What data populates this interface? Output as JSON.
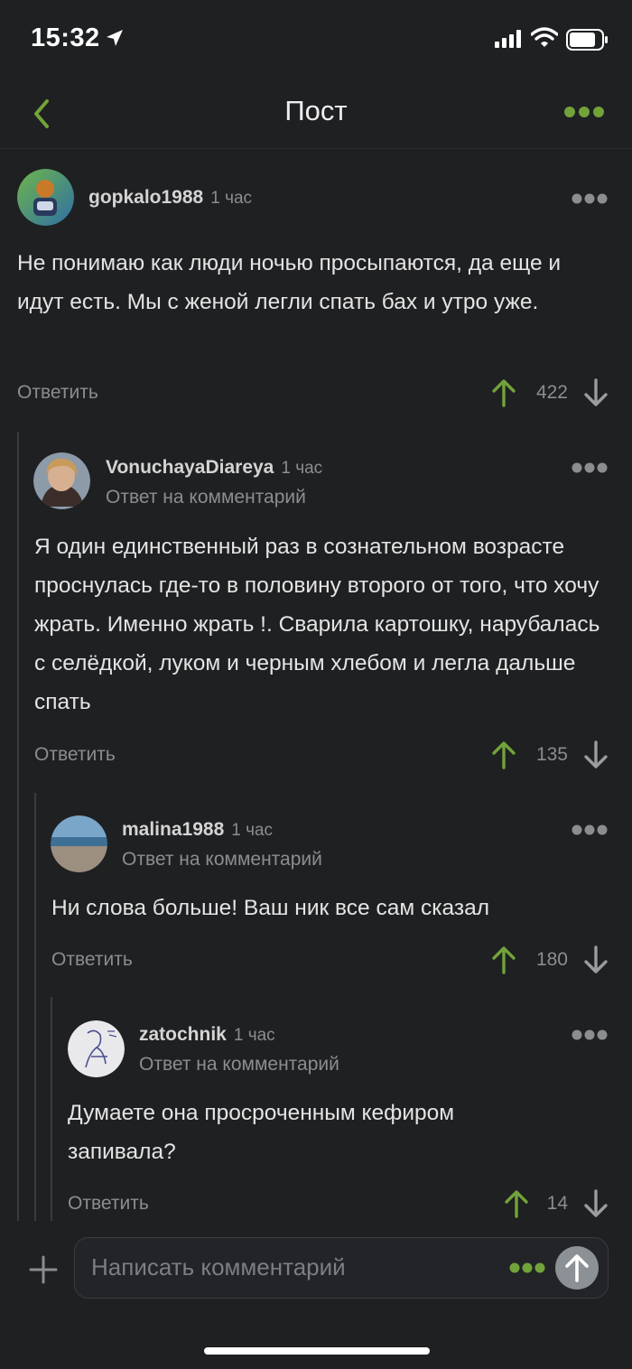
{
  "status_bar": {
    "time": "15:32"
  },
  "nav": {
    "title": "Пост"
  },
  "colors": {
    "accent": "#71a33a",
    "background": "#1f2022",
    "muted": "#8b8d91"
  },
  "icons": [
    "location-arrow-icon",
    "signal-icon",
    "wifi-icon",
    "battery-icon",
    "chevron-left-icon",
    "more-dots-icon",
    "arrow-up-icon",
    "arrow-down-icon",
    "plus-icon",
    "send-arrow-icon"
  ],
  "comments": [
    {
      "author": "gopkalo1988",
      "time": "1 час",
      "reply_to": "",
      "text": "Не понимаю как люди ночью просыпаются, да еще и идут есть. Мы с женой легли спать бах и утро уже.",
      "reply_label": "Ответить",
      "score": "422"
    },
    {
      "author": "VonuchayaDiareya",
      "time": "1 час",
      "reply_to": "Ответ на комментарий",
      "text": "Я один единственный раз в сознательном возрасте проснулась где-то в половину второго от того, что хочу жрать. Именно жрать !. Сварила картошку, нарубалась с селёдкой, луком и черным хлебом и легла дальше спать",
      "reply_label": "Ответить",
      "score": "135"
    },
    {
      "author": "malina1988",
      "time": "1 час",
      "reply_to": "Ответ на комментарий",
      "text": "Ни слова больше! Ваш ник все сам сказал",
      "reply_label": "Ответить",
      "score": "180"
    },
    {
      "author": "zatochnik",
      "time": "1 час",
      "reply_to": "Ответ на комментарий",
      "text": "Думаете она просроченным кефиром запивала?",
      "reply_label": "Ответить",
      "score": "14"
    }
  ],
  "composer": {
    "placeholder": "Написать комментарий"
  }
}
